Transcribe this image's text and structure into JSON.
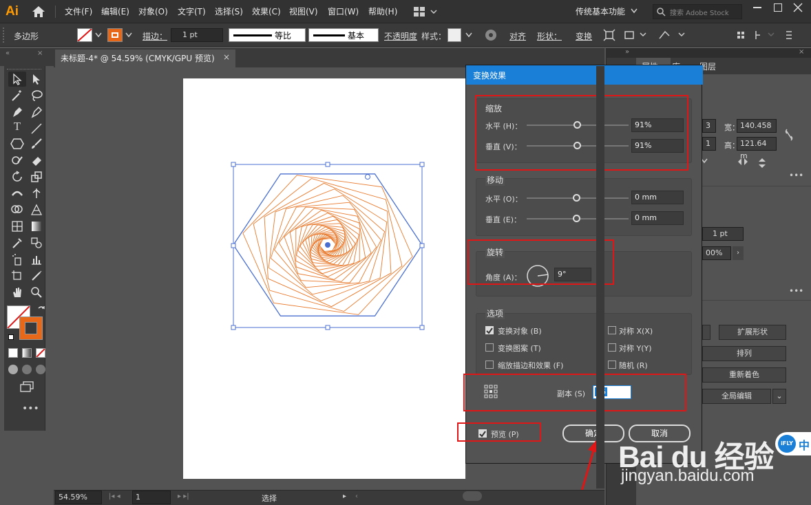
{
  "app": {
    "logo": "Ai",
    "menu": [
      "文件(F)",
      "编辑(E)",
      "对象(O)",
      "文字(T)",
      "选择(S)",
      "效果(C)",
      "视图(V)",
      "窗口(W)",
      "帮助(H)"
    ],
    "workspace": "传统基本功能",
    "search_placeholder": "搜索 Adobe Stock"
  },
  "control_bar": {
    "object_type": "多边形",
    "stroke_label": "描边：",
    "stroke_weight": "1 pt",
    "profile_label": "等比",
    "brush_label": "基本",
    "opacity_label": "不透明度",
    "style_label": "样式：",
    "align_label": "对齐",
    "shape_label": "形状：",
    "transform_label": "变换"
  },
  "document_tab": {
    "title": "未标题-4* @ 54.59% (CMYK/GPU 预览)",
    "close": "×"
  },
  "right_panel": {
    "tabs": [
      "属性",
      "库",
      "图层"
    ],
    "width_label": "宽：",
    "width_value": "140.458",
    "height_label": "高：",
    "height_value": "121.64 m",
    "x_partial": "3",
    "y_partial": "1",
    "stroke_value": "1 pt",
    "opacity_value": "00%",
    "expand_shape": "扩展形状",
    "arrange": "排列",
    "recolor": "重新着色",
    "global_edit": "全局编辑"
  },
  "dialog": {
    "title": "变换效果",
    "scale": {
      "label": "缩放",
      "horizontal_label": "水平 (H)：",
      "horizontal_value": "91%",
      "horizontal_level": 0.5,
      "vertical_label": "垂直 (V)：",
      "vertical_value": "91%",
      "vertical_level": 0.5
    },
    "move": {
      "label": "移动",
      "horizontal_label": "水平 (O)：",
      "horizontal_value": "0 mm",
      "vertical_label": "垂直 (E)：",
      "vertical_value": "0 mm"
    },
    "rotate": {
      "label": "旋转",
      "angle_label": "角度 (A)：",
      "angle_value": "9°"
    },
    "options": {
      "label": "选项",
      "transform_objects": "变换对象 (B)",
      "transform_objects_checked": true,
      "transform_patterns": "变换图案 (T)",
      "transform_patterns_checked": false,
      "scale_strokes": "缩放描边和效果 (F)",
      "scale_strokes_checked": false,
      "reflect_x": "对称 X(X)",
      "reflect_x_checked": false,
      "reflect_y": "对称 Y(Y)",
      "reflect_y_checked": false,
      "random": "随机 (R)",
      "random_checked": false
    },
    "copies_label": "副本 (S)",
    "copies_value": "26",
    "preview_label": "预览 (P)",
    "preview_checked": true,
    "ok_label": "确定",
    "cancel_label": "取消"
  },
  "status_bar": {
    "zoom": "54.59%",
    "artboard_num": "1",
    "tool_status": "选择"
  },
  "watermark": {
    "brand": "Bai du 经验",
    "url": "jingyan.baidu.com",
    "ifly": "iFLY",
    "ifly_suffix": "中"
  },
  "colors": {
    "accent_blue": "#1a7fd6",
    "annotation_red": "#e01515",
    "shape_orange": "#e8782a",
    "selection_blue": "#4a6fd0"
  }
}
